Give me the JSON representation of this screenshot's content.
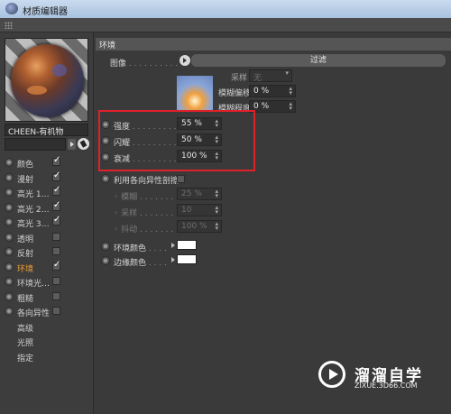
{
  "window": {
    "title": "材质编辑器"
  },
  "material": {
    "name": "CHEEN-有机物"
  },
  "channels": [
    {
      "label": "颜色",
      "checked": true,
      "active": false
    },
    {
      "label": "漫射",
      "checked": true,
      "active": false
    },
    {
      "label": "高光 1…",
      "checked": true,
      "active": false
    },
    {
      "label": "高光 2…",
      "checked": true,
      "active": false
    },
    {
      "label": "高光 3…",
      "checked": true,
      "active": false
    },
    {
      "label": "透明",
      "checked": false,
      "active": false
    },
    {
      "label": "反射",
      "checked": false,
      "active": false
    },
    {
      "label": "环境",
      "checked": true,
      "active": true
    },
    {
      "label": "环境光…",
      "checked": false,
      "active": false
    },
    {
      "label": "粗糙",
      "checked": false,
      "active": false
    },
    {
      "label": "各向异性",
      "checked": false,
      "active": false
    },
    {
      "label": "高级",
      "checked": null,
      "active": false
    },
    {
      "label": "光照",
      "checked": null,
      "active": false
    },
    {
      "label": "指定",
      "checked": null,
      "active": false
    }
  ],
  "section": {
    "title": "环境"
  },
  "image": {
    "label": "图像",
    "filter_button": "过滤"
  },
  "sampling": {
    "label": "采样",
    "value": "无",
    "blur_offset_label": "模糊偏移",
    "blur_offset_value": "0 %",
    "blur_degree_label": "模糊程度",
    "blur_degree_value": "0 %"
  },
  "params": {
    "strength_label": "强度",
    "strength_value": "55 %",
    "flicker_label": "闪耀",
    "flicker_value": "50 %",
    "falloff_label": "衰减",
    "falloff_value": "100 %"
  },
  "anisotropy": {
    "toggle_label": "利用各向异性剖擦",
    "blur_label": "模糊",
    "blur_value": "25 %",
    "sample_label": "采样",
    "sample_value": "10",
    "jitter_label": "抖动",
    "jitter_value": "100 %"
  },
  "colors": {
    "env_color_label": "环境颜色",
    "edge_color_label": "边缘颜色",
    "env_color": "#ffffff",
    "edge_color": "#ffffff"
  },
  "watermark": {
    "name": "溜溜自学",
    "url": "ZIXUE.3D66.COM"
  }
}
